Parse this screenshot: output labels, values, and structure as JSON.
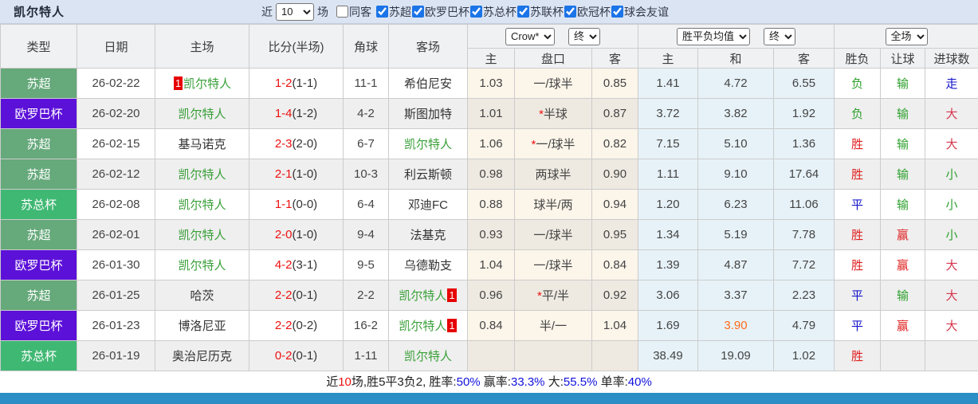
{
  "header": {
    "title": "凯尔特人",
    "recent_label": "近",
    "recent_value": "10",
    "matches_label": "场",
    "filters": [
      {
        "label": "同客",
        "checked": false
      },
      {
        "label": "苏超",
        "checked": true
      },
      {
        "label": "欧罗巴杯",
        "checked": true
      },
      {
        "label": "苏总杯",
        "checked": true
      },
      {
        "label": "苏联杯",
        "checked": true
      },
      {
        "label": "欧冠杯",
        "checked": true
      },
      {
        "label": "球会友谊",
        "checked": true
      }
    ]
  },
  "table": {
    "main_columns": [
      "类型",
      "日期",
      "主场",
      "比分(半场)",
      "角球",
      "客场"
    ],
    "sub_columns": [
      "主",
      "盘口",
      "客",
      "主",
      "和",
      "客",
      "胜负",
      "让球",
      "进球数"
    ],
    "dropdowns": {
      "company": "Crow*",
      "company_stage": "终",
      "avg": "胜平负均值",
      "avg_stage": "终",
      "scope": "全场"
    },
    "rows": [
      {
        "type": "苏超",
        "date": "26-02-22",
        "home": "凯尔特人",
        "home_self": true,
        "home_badge": "1",
        "score": "1-2",
        "half": "(1-1)",
        "corner": "11-1",
        "away": "希伯尼安",
        "away_self": false,
        "away_badge": "",
        "oh": "1.03",
        "star": false,
        "hcap": "一/球半",
        "oa": "0.85",
        "ah": "1.41",
        "ad": "4.72",
        "aa": "6.55",
        "ad_hot": false,
        "res": "负",
        "hres": "输",
        "gres": "走"
      },
      {
        "type": "欧罗巴杯",
        "date": "26-02-20",
        "home": "凯尔特人",
        "home_self": true,
        "home_badge": "",
        "score": "1-4",
        "half": "(1-2)",
        "corner": "4-2",
        "away": "斯图加特",
        "away_self": false,
        "away_badge": "",
        "oh": "1.01",
        "star": true,
        "hcap": "半球",
        "oa": "0.87",
        "ah": "3.72",
        "ad": "3.82",
        "aa": "1.92",
        "ad_hot": false,
        "res": "负",
        "hres": "输",
        "gres": "大"
      },
      {
        "type": "苏超",
        "date": "26-02-15",
        "home": "基马诺克",
        "home_self": false,
        "home_badge": "",
        "score": "2-3",
        "half": "(2-0)",
        "corner": "6-7",
        "away": "凯尔特人",
        "away_self": true,
        "away_badge": "",
        "oh": "1.06",
        "star": true,
        "hcap": "一/球半",
        "oa": "0.82",
        "ah": "7.15",
        "ad": "5.10",
        "aa": "1.36",
        "ad_hot": false,
        "res": "胜",
        "hres": "输",
        "gres": "大"
      },
      {
        "type": "苏超",
        "date": "26-02-12",
        "home": "凯尔特人",
        "home_self": true,
        "home_badge": "",
        "score": "2-1",
        "half": "(1-0)",
        "corner": "10-3",
        "away": "利云斯顿",
        "away_self": false,
        "away_badge": "",
        "oh": "0.98",
        "star": false,
        "hcap": "两球半",
        "oa": "0.90",
        "ah": "1.11",
        "ad": "9.10",
        "aa": "17.64",
        "ad_hot": false,
        "res": "胜",
        "hres": "输",
        "gres": "小"
      },
      {
        "type": "苏总杯",
        "date": "26-02-08",
        "home": "凯尔特人",
        "home_self": true,
        "home_badge": "",
        "score": "1-1",
        "half": "(0-0)",
        "corner": "6-4",
        "away": "邓迪FC",
        "away_self": false,
        "away_badge": "",
        "oh": "0.88",
        "star": false,
        "hcap": "球半/两",
        "oa": "0.94",
        "ah": "1.20",
        "ad": "6.23",
        "aa": "11.06",
        "ad_hot": false,
        "res": "平",
        "hres": "输",
        "gres": "小"
      },
      {
        "type": "苏超",
        "date": "26-02-01",
        "home": "凯尔特人",
        "home_self": true,
        "home_badge": "",
        "score": "2-0",
        "half": "(1-0)",
        "corner": "9-4",
        "away": "法基克",
        "away_self": false,
        "away_badge": "",
        "oh": "0.93",
        "star": false,
        "hcap": "一/球半",
        "oa": "0.95",
        "ah": "1.34",
        "ad": "5.19",
        "aa": "7.78",
        "ad_hot": false,
        "res": "胜",
        "hres": "赢",
        "gres": "小"
      },
      {
        "type": "欧罗巴杯",
        "date": "26-01-30",
        "home": "凯尔特人",
        "home_self": true,
        "home_badge": "",
        "score": "4-2",
        "half": "(3-1)",
        "corner": "9-5",
        "away": "乌德勒支",
        "away_self": false,
        "away_badge": "",
        "oh": "1.04",
        "star": false,
        "hcap": "一/球半",
        "oa": "0.84",
        "ah": "1.39",
        "ad": "4.87",
        "aa": "7.72",
        "ad_hot": false,
        "res": "胜",
        "hres": "赢",
        "gres": "大"
      },
      {
        "type": "苏超",
        "date": "26-01-25",
        "home": "哈茨",
        "home_self": false,
        "home_badge": "",
        "score": "2-2",
        "half": "(0-1)",
        "corner": "2-2",
        "away": "凯尔特人",
        "away_self": true,
        "away_badge": "1",
        "oh": "0.96",
        "star": true,
        "hcap": "平/半",
        "oa": "0.92",
        "ah": "3.06",
        "ad": "3.37",
        "aa": "2.23",
        "ad_hot": false,
        "res": "平",
        "hres": "输",
        "gres": "大"
      },
      {
        "type": "欧罗巴杯",
        "date": "26-01-23",
        "home": "博洛尼亚",
        "home_self": false,
        "home_badge": "",
        "score": "2-2",
        "half": "(0-2)",
        "corner": "16-2",
        "away": "凯尔特人",
        "away_self": true,
        "away_badge": "1",
        "oh": "0.84",
        "star": false,
        "hcap": "半/一",
        "oa": "1.04",
        "ah": "1.69",
        "ad": "3.90",
        "aa": "4.79",
        "ad_hot": true,
        "res": "平",
        "hres": "赢",
        "gres": "大"
      },
      {
        "type": "苏总杯",
        "date": "26-01-19",
        "home": "奥治尼历克",
        "home_self": false,
        "home_badge": "",
        "score": "0-2",
        "half": "(0-1)",
        "corner": "1-11",
        "away": "凯尔特人",
        "away_self": true,
        "away_badge": "",
        "oh": "",
        "star": false,
        "hcap": "",
        "oa": "",
        "ah": "38.49",
        "ad": "19.09",
        "aa": "1.02",
        "ad_hot": false,
        "res": "胜",
        "hres": "",
        "gres": ""
      }
    ]
  },
  "summary": {
    "parts": [
      {
        "text": "近",
        "color": "dark"
      },
      {
        "text": "10",
        "color": "red"
      },
      {
        "text": "场,胜5平3负2, 胜率:",
        "color": "dark"
      },
      {
        "text": "50%",
        "color": "blue"
      },
      {
        "text": " 赢率:",
        "color": "dark"
      },
      {
        "text": "33.3%",
        "color": "blue"
      },
      {
        "text": " 大:",
        "color": "dark"
      },
      {
        "text": "55.5%",
        "color": "blue"
      },
      {
        "text": " 单率:",
        "color": "dark"
      },
      {
        "text": "40%",
        "color": "blue"
      }
    ]
  },
  "colors": {
    "league": {
      "苏超": "#66a97b",
      "欧罗巴杯": "#5c11d8",
      "苏总杯": "#3fb873"
    },
    "results": {
      "胜": "#e02020",
      "平": "#1414cc",
      "负": "#2fa12f",
      "赢": "#e02020",
      "输": "#2fa12f",
      "大": "#d6364e",
      "小": "#2fa12f",
      "走": "#1414cc"
    },
    "self_team_green": "#3aa03a",
    "score_red": "#ee1111",
    "hot_orange": "#ff6a1a",
    "badge_red": "#e60000",
    "topbar_bg": "#dbe4f2",
    "bottom_bar_blue": "#2b8ec5",
    "summary_blue": "#1111dd"
  }
}
